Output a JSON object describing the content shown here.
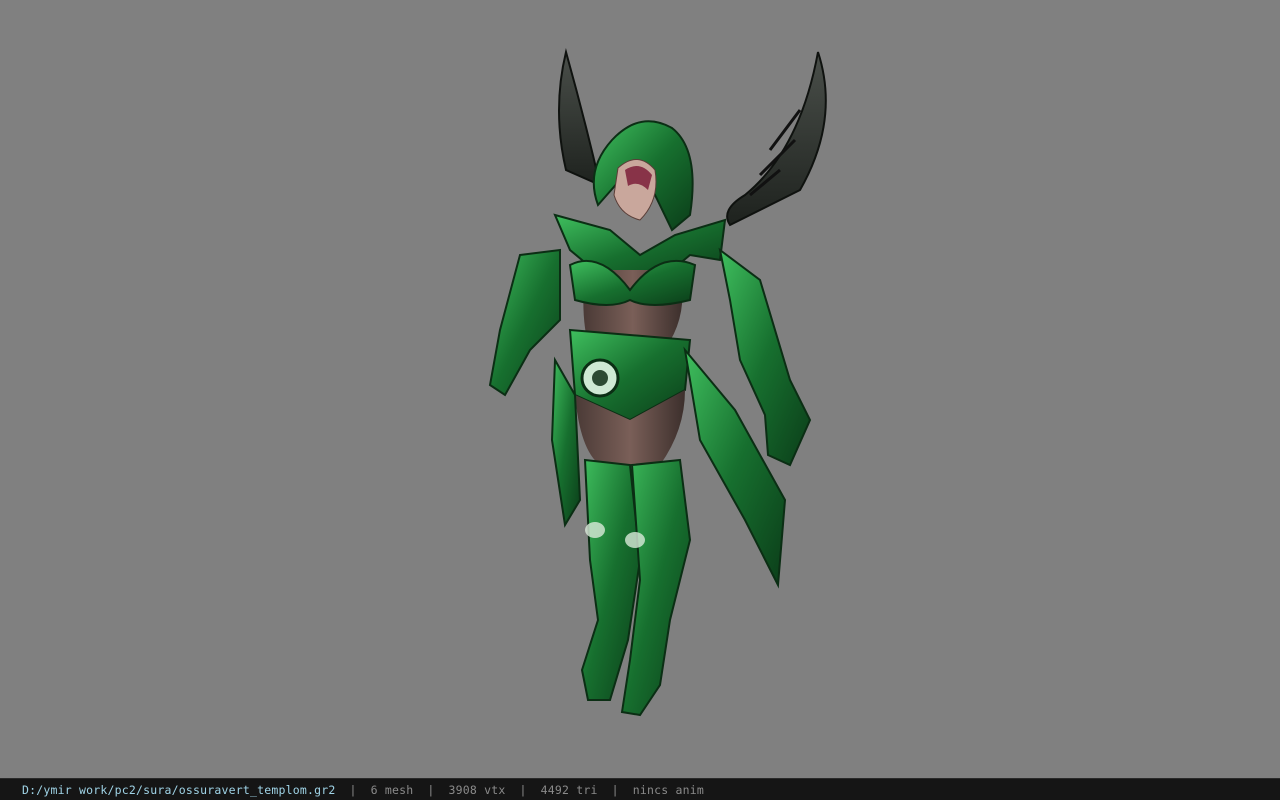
{
  "viewer": {
    "background_color": "#808080",
    "model": {
      "name": "ossuravert_templom",
      "armor_color": "#1f8a3c",
      "wing_color": "#2b2f2b"
    }
  },
  "status_bar": {
    "file_path": "D:/ymir work/pc2/sura/ossuravert_templom.gr2",
    "separator": "|",
    "mesh": "6 mesh",
    "vertices": "3908 vtx",
    "triangles": "4492 tri",
    "animation": "nincs anim"
  }
}
